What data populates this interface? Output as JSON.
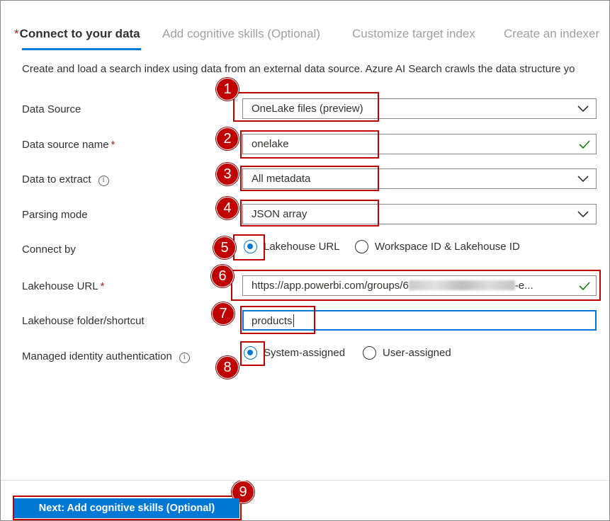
{
  "tabs": [
    {
      "label": "Connect to your data",
      "required_marker": "*"
    },
    {
      "label": "Add cognitive skills (Optional)"
    },
    {
      "label": "Customize target index"
    },
    {
      "label": "Create an indexer"
    }
  ],
  "intro": "Create and load a search index using data from an external data source. Azure AI Search crawls the data structure yo",
  "form": {
    "data_source": {
      "label": "Data Source",
      "value": "OneLake files (preview)"
    },
    "data_source_name": {
      "label": "Data source name",
      "required": "*",
      "value": "onelake"
    },
    "data_to_extract": {
      "label": "Data to extract",
      "info": "i",
      "value": "All metadata"
    },
    "parsing_mode": {
      "label": "Parsing mode",
      "value": "JSON array"
    },
    "connect_by": {
      "label": "Connect by",
      "options": [
        "Lakehouse URL",
        "Workspace ID & Lakehouse ID"
      ],
      "selected": "Lakehouse URL"
    },
    "lakehouse_url": {
      "label": "Lakehouse URL",
      "required": "*",
      "value_prefix": "https://app.powerbi.com/groups/6",
      "value_suffix": "-e..."
    },
    "lakehouse_folder": {
      "label": "Lakehouse folder/shortcut",
      "value": "products"
    },
    "managed_identity": {
      "label": "Managed identity authentication",
      "info": "i",
      "options": [
        "System-assigned",
        "User-assigned"
      ],
      "selected": "System-assigned"
    }
  },
  "badges": [
    "1",
    "2",
    "3",
    "4",
    "5",
    "6",
    "7",
    "8",
    "9"
  ],
  "footer": {
    "next_label": "Next: Add cognitive skills (Optional)"
  },
  "colors": {
    "accent": "#0078d4",
    "highlight": "#c00000",
    "valid": "#107c10"
  }
}
